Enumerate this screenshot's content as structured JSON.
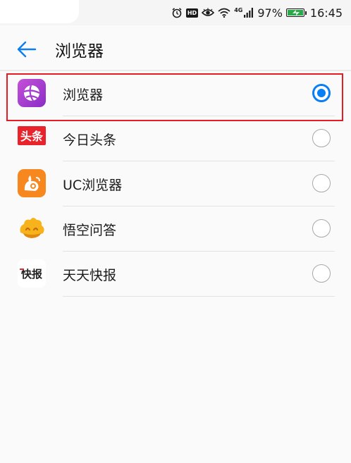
{
  "status_bar": {
    "icons": [
      "alarm-icon",
      "hd-icon",
      "eye-comfort-icon",
      "wifi-icon",
      "signal-icon",
      "battery-icon"
    ],
    "hd_label": "HD",
    "network_label": "4G",
    "battery_percent": "97%",
    "time": "16:45"
  },
  "app_bar": {
    "back_icon": "arrow-left-icon",
    "title": "浏览器",
    "accent_color": "#0a7ef5"
  },
  "options": [
    {
      "label": "浏览器",
      "icon": "huawei-browser-icon",
      "selected": true
    },
    {
      "label": "今日头条",
      "icon": "toutiao-icon",
      "selected": false
    },
    {
      "label": "UC浏览器",
      "icon": "uc-browser-icon",
      "selected": false
    },
    {
      "label": "悟空问答",
      "icon": "wukong-icon",
      "selected": false
    },
    {
      "label": "天天快报",
      "icon": "kuaibao-icon",
      "selected": false
    }
  ],
  "icon_text": {
    "toutiao": "头条",
    "kuaibao": "快报"
  },
  "highlight_color": "#e51c23"
}
